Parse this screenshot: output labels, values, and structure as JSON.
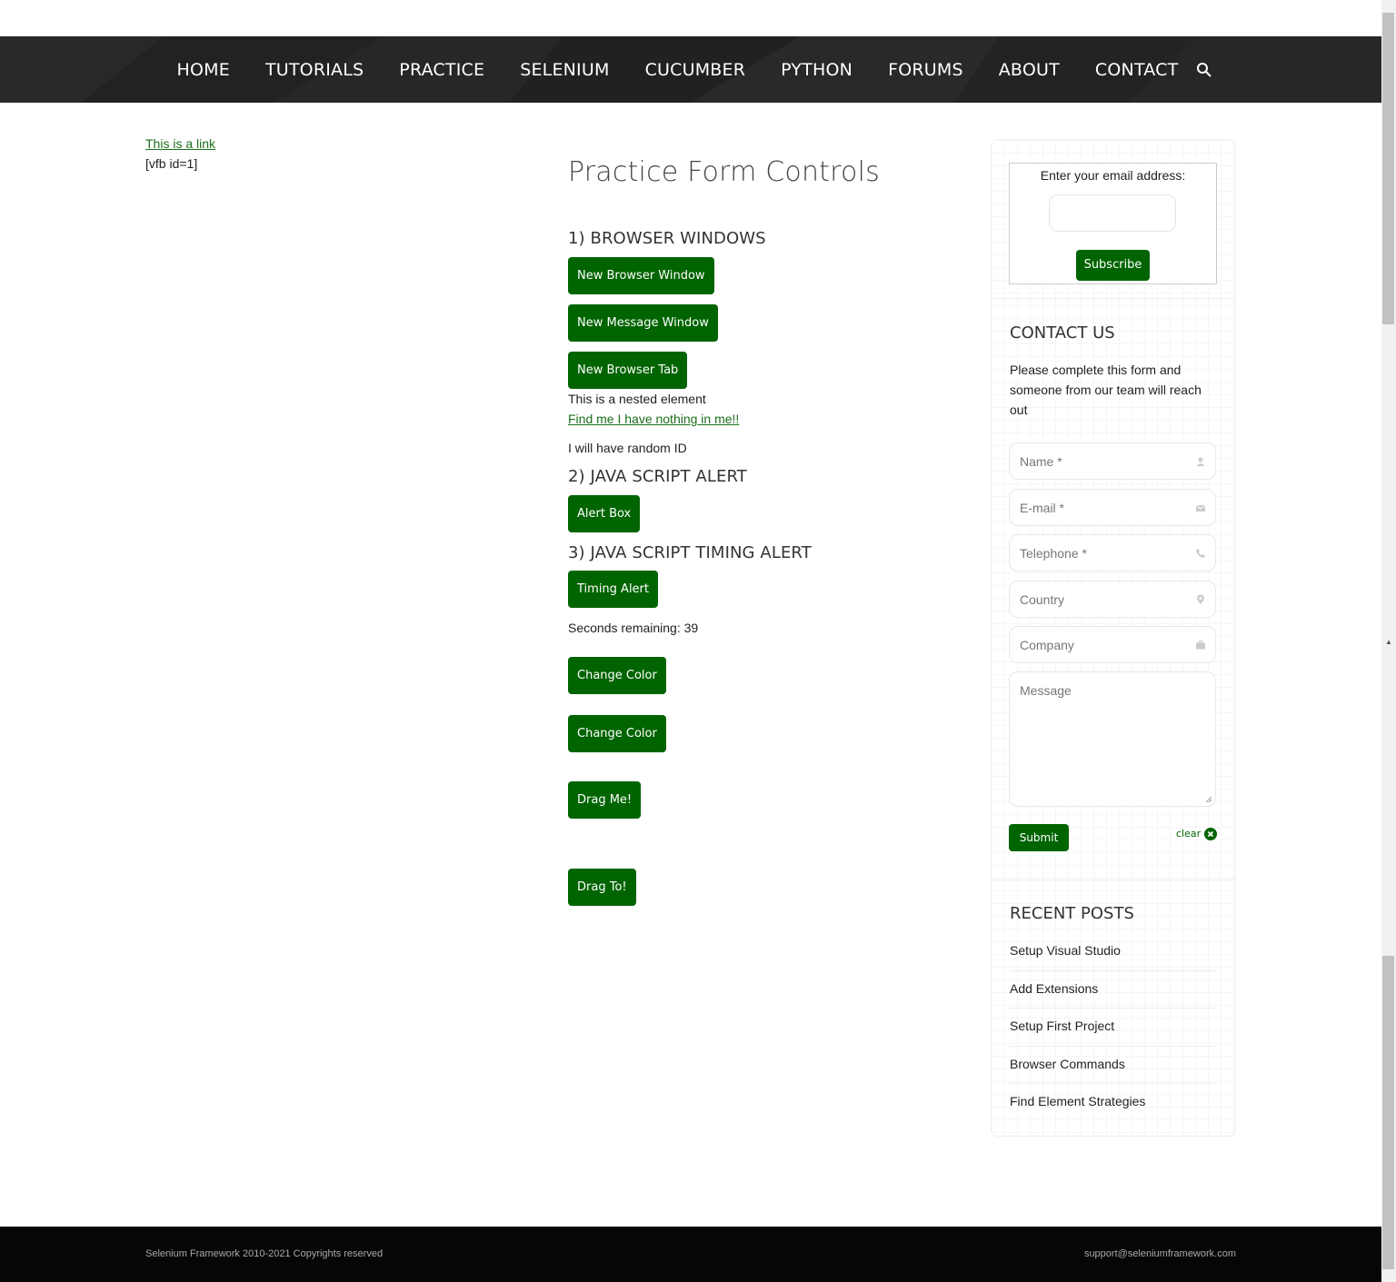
{
  "nav": {
    "items": [
      "HOME",
      "TUTORIALS",
      "PRACTICE",
      "SELENIUM",
      "CUCUMBER",
      "PYTHON",
      "FORUMS",
      "ABOUT",
      "CONTACT"
    ],
    "search_icon": "search-icon"
  },
  "left": {
    "link": "This is a link",
    "shortcode": "[vfb id=1]"
  },
  "main": {
    "title": "Practice Form Controls",
    "section1": "1) BROWSER WINDOWS",
    "new_browser_window": "New Browser Window",
    "new_message_window": "New Message Window",
    "new_browser_tab": "New Browser Tab",
    "nested_text": "This is a nested element",
    "find_me_link": "Find me I have nothing in me!!",
    "random_id_text": "I will have random ID",
    "section2": "2) JAVA SCRIPT ALERT",
    "alert_box": "Alert Box",
    "section3": "3) JAVA SCRIPT TIMING ALERT",
    "timing_alert": "Timing Alert",
    "seconds_remaining": "Seconds remaining: 39",
    "change_color_1": "Change Color",
    "change_color_2": "Change Color",
    "drag_me": "Drag Me!",
    "drag_to": "Drag To!"
  },
  "sidebar": {
    "subscribe_label": "Enter your email address:",
    "subscribe_button": "Subscribe",
    "contact_heading": "CONTACT US",
    "contact_text": "Please complete this form and someone from our team will reach out",
    "fields": {
      "name": "Name *",
      "email": "E-mail *",
      "telephone": "Telephone *",
      "country": "Country",
      "company": "Company",
      "message": "Message"
    },
    "submit": "Submit",
    "clear": "clear",
    "recent_heading": "RECENT POSTS",
    "posts": [
      "Setup Visual Studio",
      "Add Extensions",
      "Setup First Project",
      "Browser Commands",
      "Find Element Strategies"
    ]
  },
  "footer": {
    "copyright": "Selenium Framework 2010-2021 Copyrights reserved",
    "email": "support@seleniumframework.com"
  },
  "colors": {
    "accent": "#006400",
    "nav_bg": "#222426",
    "footer_bg": "#060606"
  }
}
